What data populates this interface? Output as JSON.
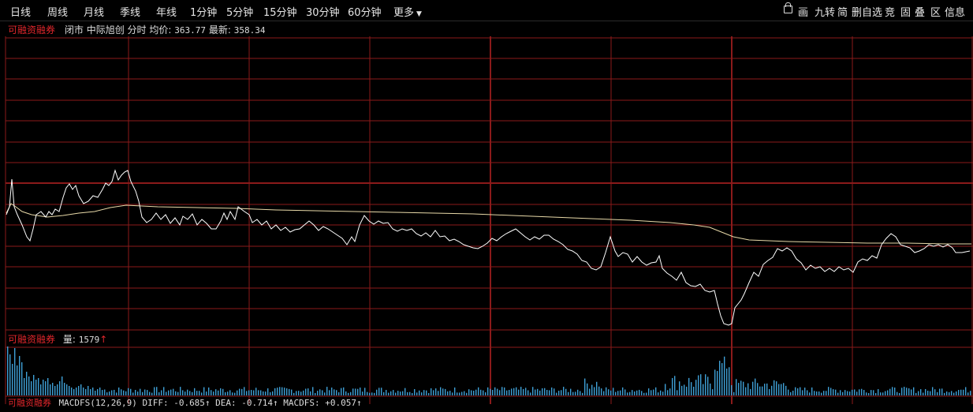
{
  "toolbar": {
    "tabs": [
      "日线",
      "周线",
      "月线",
      "季线",
      "年线",
      "1分钟",
      "5分钟",
      "15分钟",
      "30分钟",
      "60分钟"
    ],
    "more": "更多",
    "right_items": [
      "画",
      "九转",
      "简",
      "删自选",
      "竞",
      "固",
      "叠",
      "区",
      "信息"
    ]
  },
  "main_panel": {
    "indicator": "可融资融券",
    "status": "闭市",
    "stock_name": "中际旭创",
    "mode": "分时",
    "avg_label": "均价:",
    "avg_value": "363.77",
    "last_label": "最新:",
    "last_value": "358.34"
  },
  "volume_panel": {
    "indicator": "可融资融券",
    "label": "量:",
    "value": "1579",
    "arrow": "↑"
  },
  "macd_panel": {
    "indicator": "可融资融券",
    "text": "MACDFS(12,26,9) DIFF: -0.685↑ DEA: -0.714↑ MACDFS: +0.057↑"
  },
  "colors": {
    "grid": "#8b1a1a",
    "price_line": "#ffffff",
    "avg_line": "#e8d9a8",
    "volume_bar": "#3fa0d6",
    "label_red": "#e0262b"
  }
}
